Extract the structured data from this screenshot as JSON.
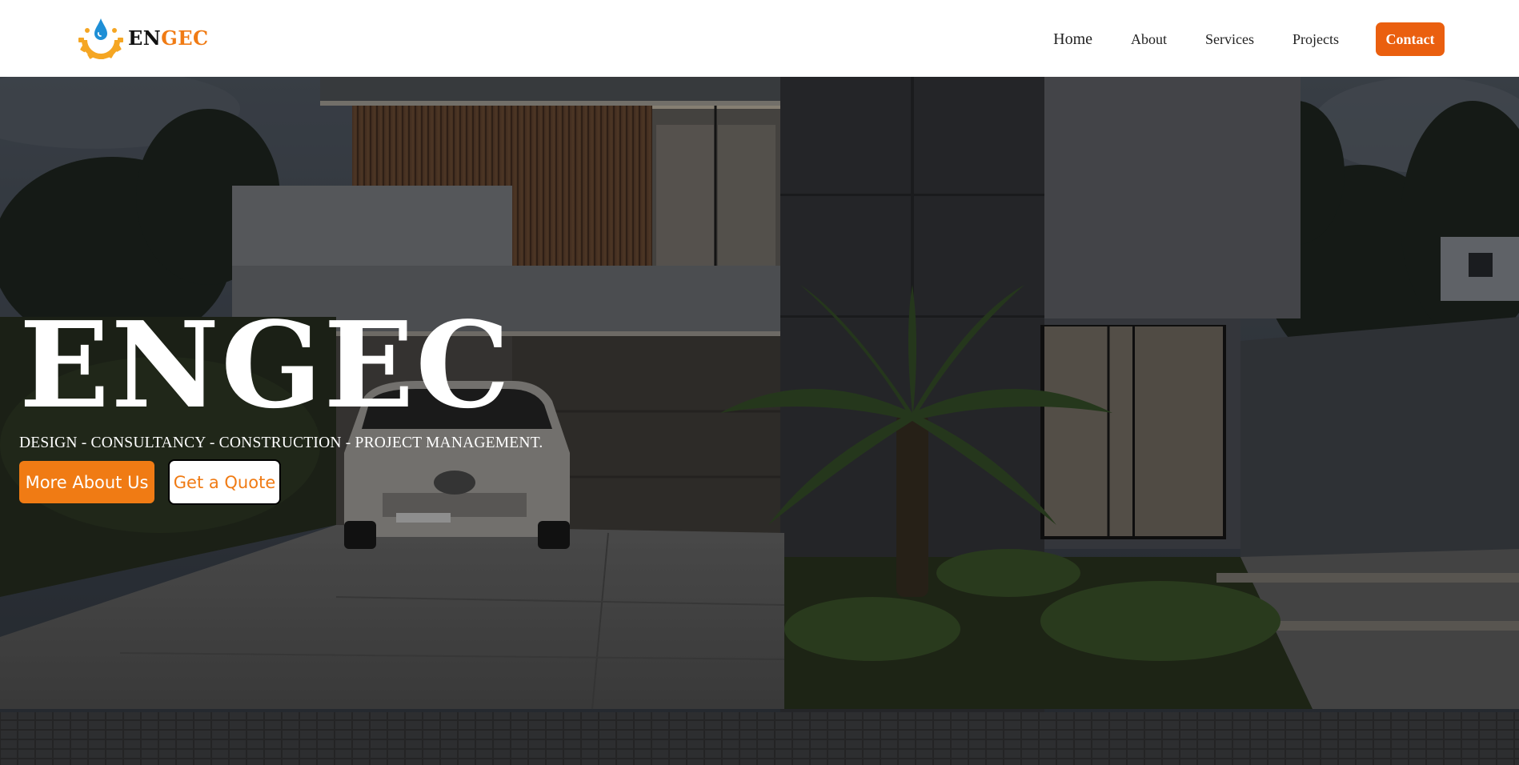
{
  "header": {
    "logo": {
      "text_dark": "EN",
      "text_accent": "GEC",
      "icon": "gear-water-drop-icon"
    },
    "nav": {
      "home": "Home",
      "about": "About",
      "services": "Services",
      "projects": "Projects",
      "contact": "Contact"
    }
  },
  "hero": {
    "title": "ENGEC",
    "tagline": "DESIGN - CONSULTANCY - CONSTRUCTION - PROJECT MANAGEMENT.",
    "primary_button": "More About Us",
    "secondary_button": "Get a Quote",
    "background_image": "modern-house-with-car-and-palm-trees"
  },
  "colors": {
    "accent": "#f07b14",
    "contact_button": "#ea5f0f",
    "header_bg": "#ffffff",
    "text_dark": "#111111",
    "hero_text": "#ffffff"
  }
}
